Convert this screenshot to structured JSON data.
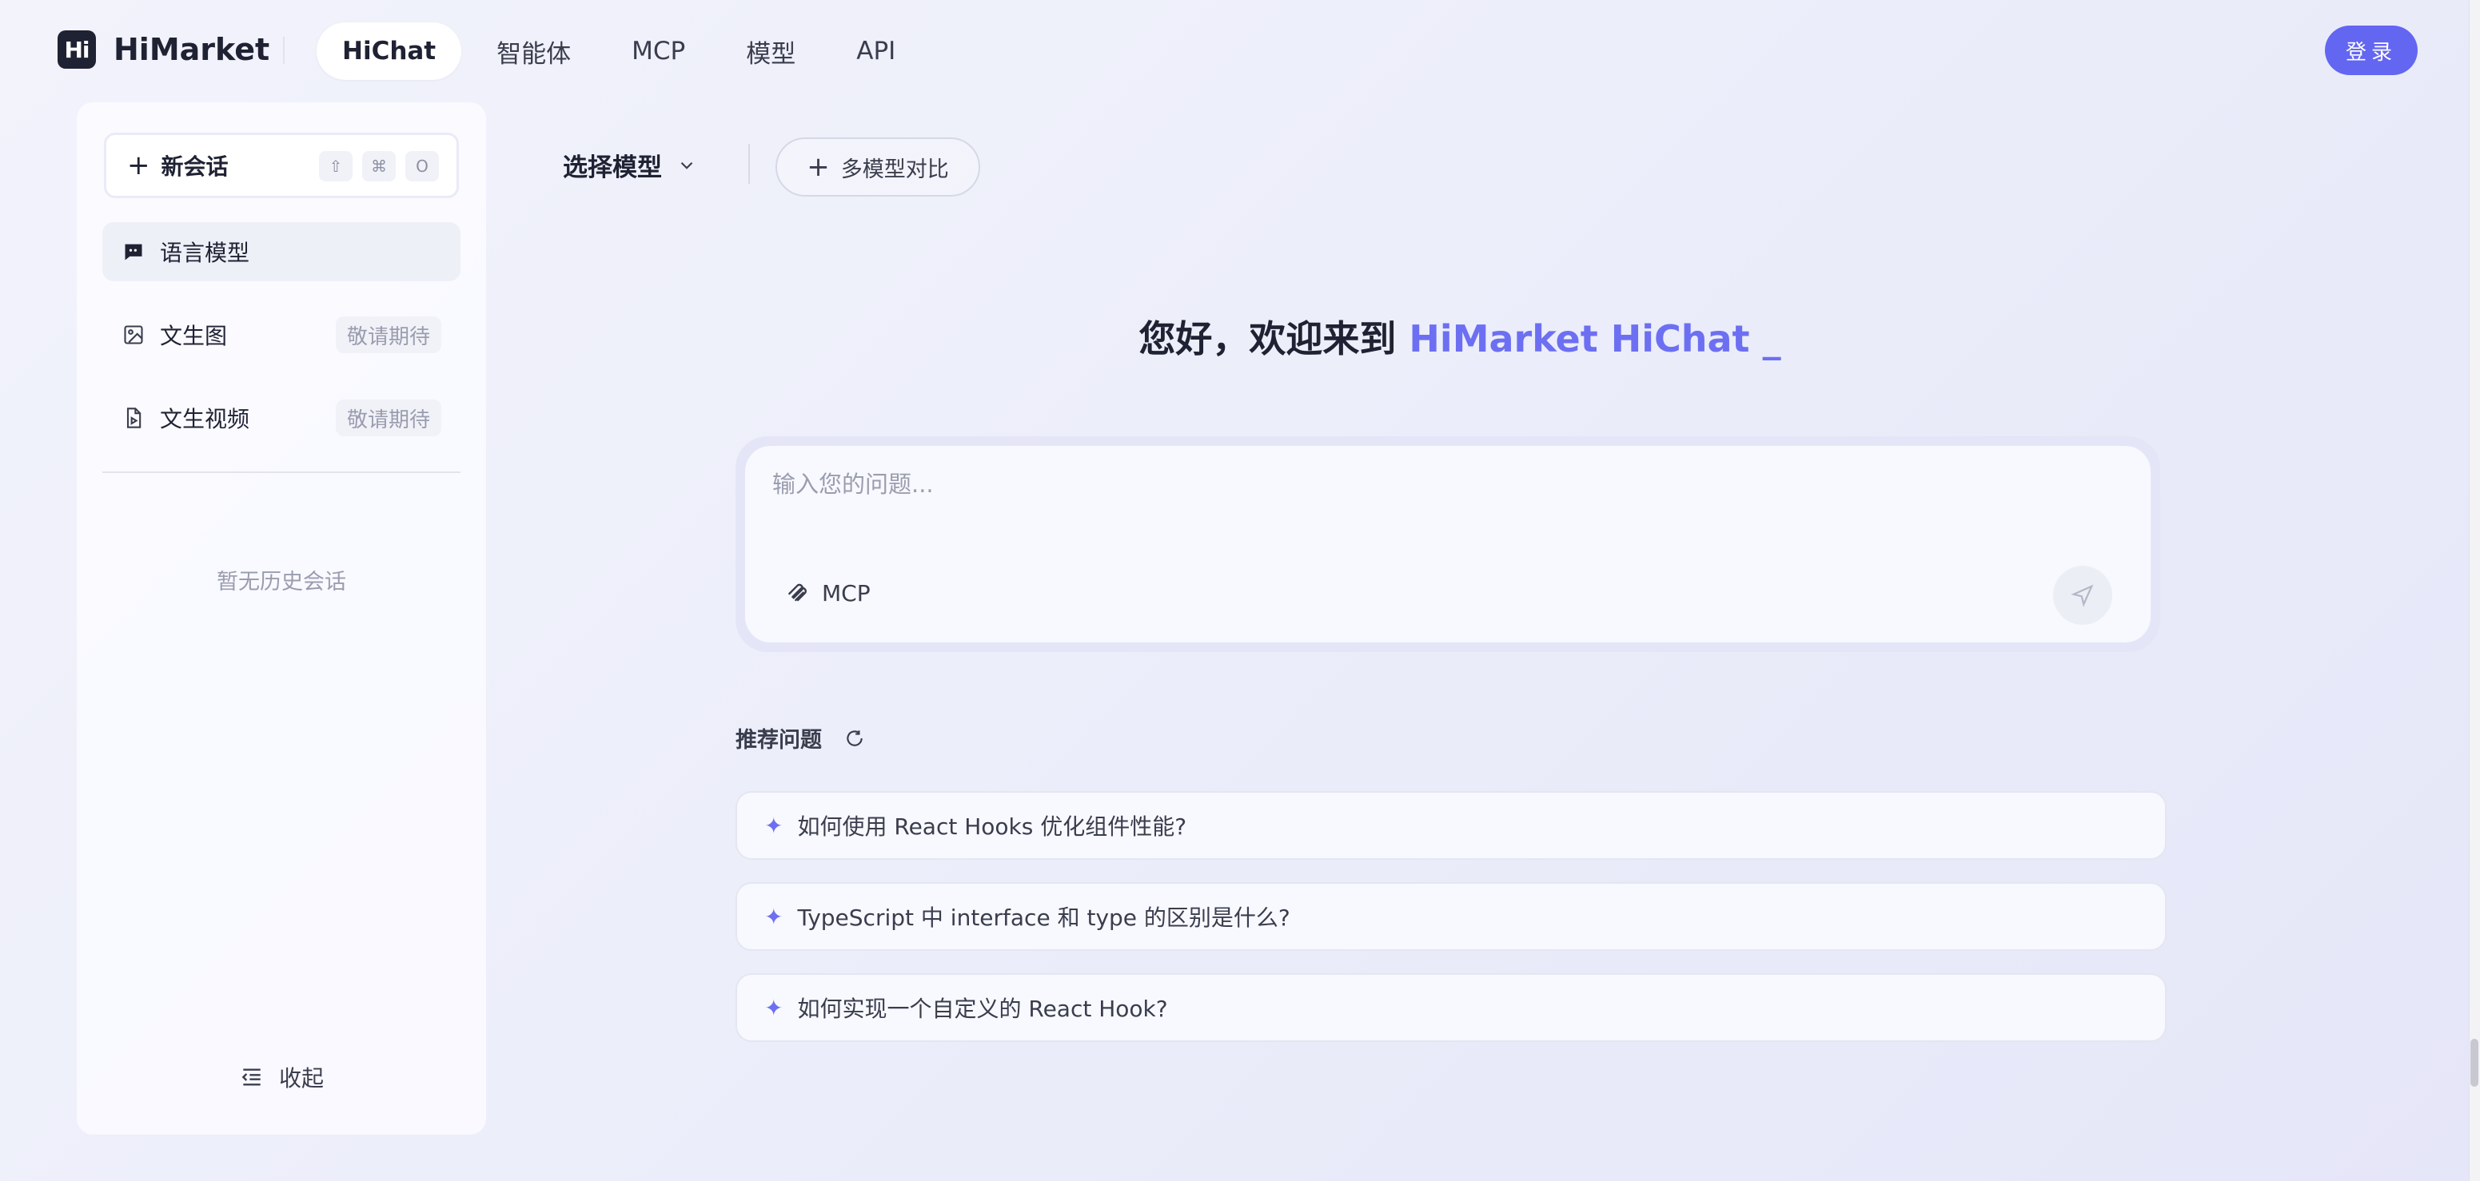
{
  "brand": {
    "logo_mark": "Hi",
    "name": "HiMarket"
  },
  "nav": {
    "items": [
      {
        "label": "HiChat",
        "active": true
      },
      {
        "label": "智能体"
      },
      {
        "label": "MCP"
      },
      {
        "label": "模型"
      },
      {
        "label": "API"
      }
    ]
  },
  "header": {
    "login_label": "登录"
  },
  "sidebar": {
    "new_chat": {
      "label": "新会话",
      "shortcuts": [
        "⇧",
        "⌘",
        "O"
      ]
    },
    "items": [
      {
        "label": "语言模型",
        "icon": "chat-bubble-icon",
        "active": true
      },
      {
        "label": "文生图",
        "icon": "image-icon",
        "badge": "敬请期待"
      },
      {
        "label": "文生视频",
        "icon": "video-file-icon",
        "badge": "敬请期待"
      }
    ],
    "empty_history": "暂无历史会话",
    "collapse_label": "收起"
  },
  "toolbar": {
    "model_select_label": "选择模型",
    "compare_label": "多模型对比"
  },
  "welcome": {
    "prefix": "您好，欢迎来到 ",
    "brand": "HiMarket HiChat _"
  },
  "chat": {
    "placeholder": "输入您的问题...",
    "mcp_label": "MCP"
  },
  "recommend": {
    "title": "推荐问题",
    "questions": [
      "如何使用 React Hooks 优化组件性能?",
      "TypeScript 中 interface 和 type 的区别是什么?",
      "如何实现一个自定义的 React Hook?"
    ]
  },
  "colors": {
    "accent": "#6366f1",
    "brand_text": "#6d6ff2",
    "dark": "#1f2233"
  }
}
